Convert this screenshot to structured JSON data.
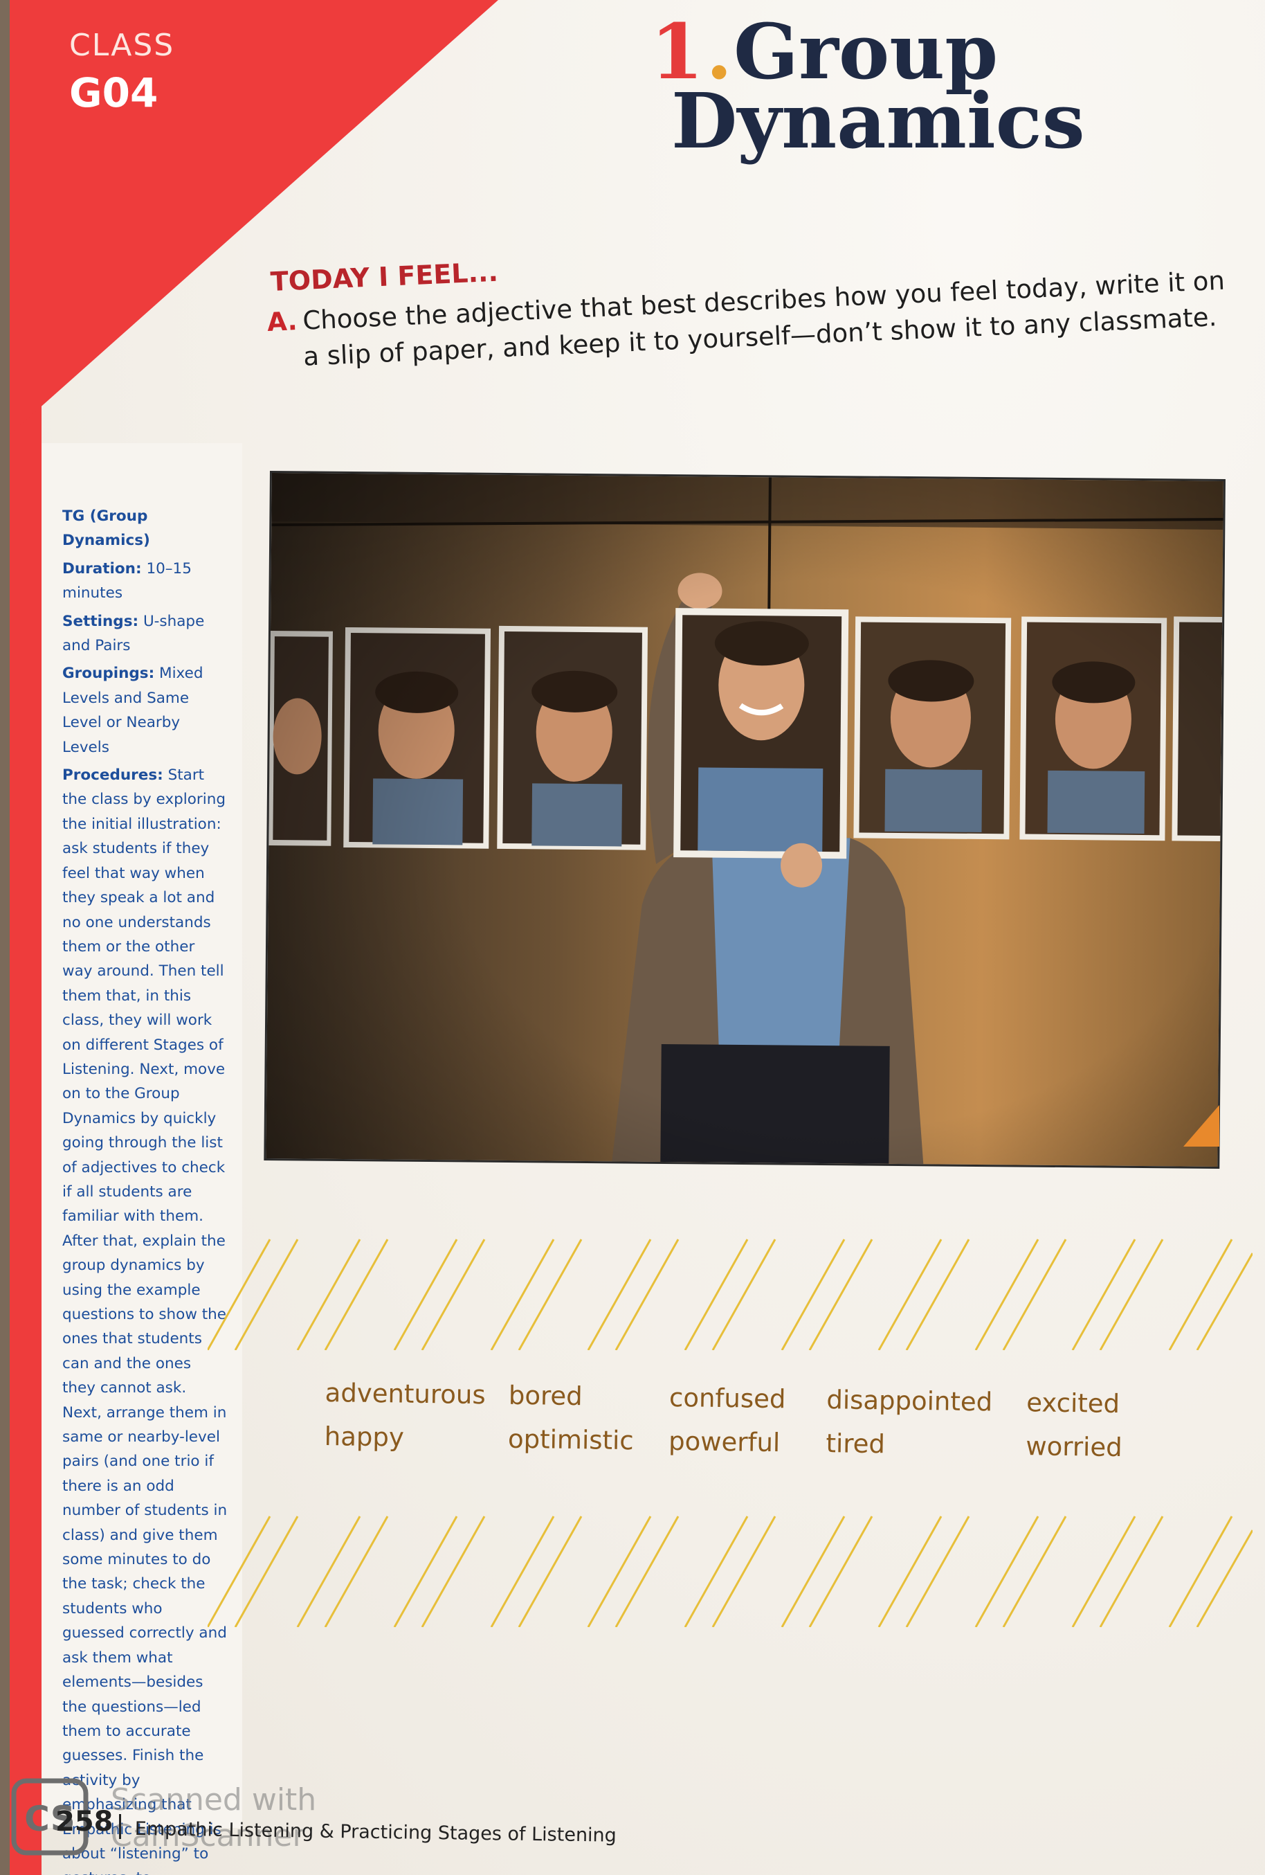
{
  "class_badge": {
    "label": "CLASS",
    "code": "G04"
  },
  "title": {
    "number": "1",
    "dot": ".",
    "line1": "Group",
    "line2": "Dynamics"
  },
  "section": {
    "heading": "TODAY I FEEL...",
    "instruction_letter": "A.",
    "instruction_line1": "Choose the adjective that best describes how you feel today, write it on",
    "instruction_line2": "a slip of paper, and keep it to yourself—don’t show it to any classmate."
  },
  "sidebar": {
    "title": "TG (Group Dynamics)",
    "duration_key": "Duration:",
    "duration_val": "10–15 minutes",
    "settings_key": "Settings:",
    "settings_val": "U-shape and Pairs",
    "groupings_key": "Groupings:",
    "groupings_val": "Mixed Levels and Same Level or Nearby Levels",
    "procedures_key": "Procedures:",
    "procedures_val": "Start the class by exploring the initial illustration: ask students if they feel that way when they speak a lot and no one understands them or the other way around. Then tell them that, in this class, they will work on different Stages of Listening. Next, move on to the Group Dynamics by quickly going through the list of adjectives to check if all students are familiar with them. After that, explain the group dynamics by using the example questions to show the ones that students can and the ones they cannot ask. Next, arrange them in same or nearby-level pairs (and one trio if there is an odd number of students in class) and give them some minutes to do the task; check the students who guessed correctly and ask them what elements—besides the questions—led them to accurate guesses. Finish the activity by emphasizing that Empathic Listening is about “listening” to gestures, to intonation, to body language, and to facial expressions."
  },
  "words": {
    "row1": [
      "adventurous",
      "bored",
      "confused",
      "disappointed",
      "excited"
    ],
    "row2": [
      "happy",
      "optimistic",
      "powerful",
      "tired",
      "worried"
    ]
  },
  "footer": {
    "page_number": "258",
    "text": "Empathic Listening & Practicing Stages of Listening"
  },
  "watermark": {
    "line1": "Scanned with",
    "line2": "CamScanner"
  },
  "colors": {
    "red": "#ee3c3c",
    "navy": "#1f2a44",
    "blue": "#1d4e9b",
    "brown": "#8a5a1e",
    "orange": "#e8892c"
  }
}
